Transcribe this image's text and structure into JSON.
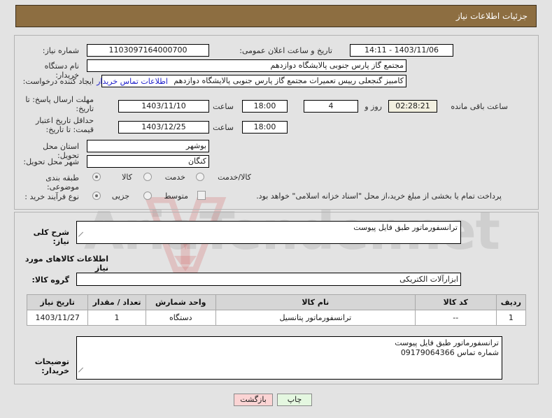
{
  "header": {
    "title": "جزئیات اطلاعات نیاز"
  },
  "form": {
    "need_number_label": "شماره نیاز:",
    "need_number_value": "1103097164000700",
    "announce_label": "تاریخ و ساعت اعلان عمومی:",
    "announce_value": "1403/11/06 - 14:11",
    "buyer_org_label": "نام دستگاه خریدار:",
    "buyer_org_value": "مجتمع گاز پارس جنوبی  پالایشگاه دوازدهم",
    "requester_label": "ایجاد کننده درخواست:",
    "requester_value": "کامبیز گنجعلی رییس تعمیرات مجتمع گاز پارس جنوبی  پالایشگاه دوازدهم",
    "buyer_contact_link": "اطلاعات تماس خریدار",
    "deadline_label": "مهلت ارسال پاسخ: تا تاریخ:",
    "deadline_date": "1403/11/10",
    "deadline_hour_label": "ساعت",
    "deadline_time": "18:00",
    "remaining_days": "4",
    "remaining_days_label": "روز و",
    "remaining_clock": "02:28:21",
    "remaining_suffix_label": "ساعت باقی مانده",
    "price_validity_label": "حداقل تاریخ اعتبار قیمت: تا تاریخ:",
    "price_validity_date": "1403/12/25",
    "price_validity_hour_label": "ساعت",
    "price_validity_time": "18:00",
    "province_label": "استان محل تحویل:",
    "province_value": "بوشهر",
    "city_label": "شهر محل تحویل:",
    "city_value": "کنگان",
    "category_label": "طبقه بندی موضوعی:",
    "category_options": [
      "کالا",
      "خدمت",
      "کالا/خدمت"
    ],
    "category_selected": "کالا",
    "process_label": "نوع فرآیند خرید :",
    "process_options": [
      "جزیی",
      "متوسط"
    ],
    "process_selected": "جزیی",
    "treasury_note": "پرداخت تمام یا بخشی از مبلغ خرید،از محل \"اسناد خزانه اسلامی\" خواهد بود.",
    "treasury_checked": false
  },
  "description": {
    "label": "شرح کلی نیاز:",
    "value": "ترانسفورماتور طبق فایل پیوست"
  },
  "goods_section": {
    "heading": "اطلاعات کالاهای مورد نیاز",
    "group_label": "گروه کالا:",
    "group_value": "ابزارآلات الکتریکی",
    "columns": [
      "ردیف",
      "کد کالا",
      "نام کالا",
      "واحد شمارش",
      "تعداد / مقدار",
      "تاریخ نیاز"
    ],
    "rows": [
      {
        "row": "1",
        "code": "--",
        "name": "ترانسفورماتور پتانسیل",
        "unit": "دستگاه",
        "qty": "1",
        "need_date": "1403/11/27"
      }
    ]
  },
  "buyer_notes": {
    "label": "توضیحات خریدار:",
    "line1": "ترانسفورماتور طبق فایل پیوست",
    "line2": "شماره تماس 09179064366"
  },
  "buttons": {
    "back": "بازگشت",
    "print": "چاپ"
  },
  "watermark": {
    "text": "AriaTender.net"
  }
}
